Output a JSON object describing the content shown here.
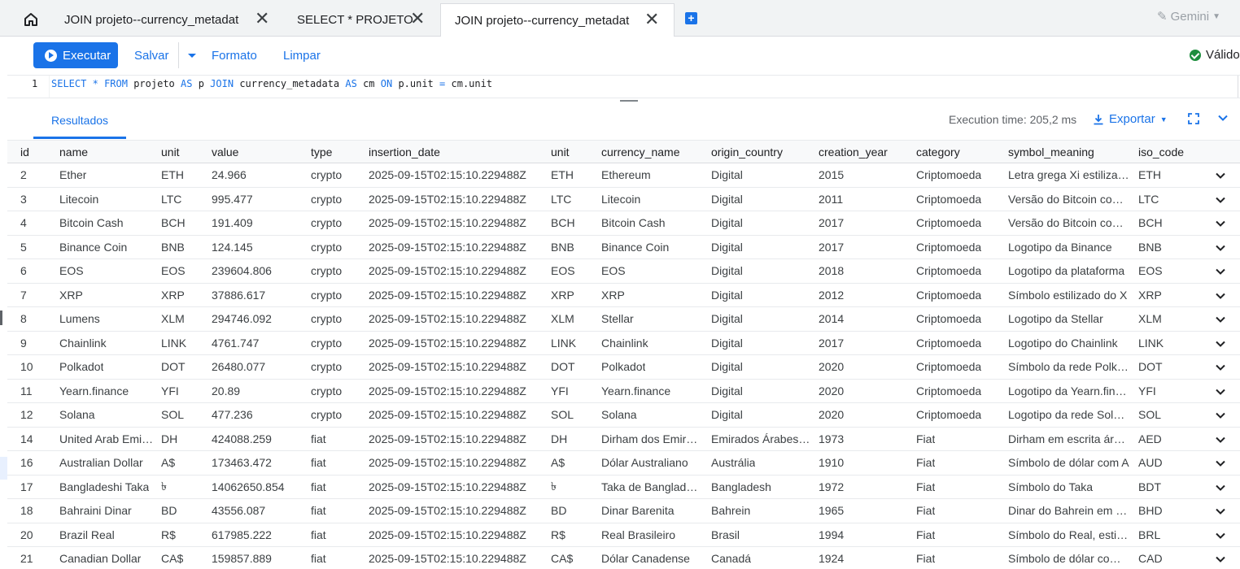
{
  "tabs": [
    {
      "label": "JOIN projeto--currency_metadat",
      "active": false
    },
    {
      "label": "SELECT * PROJETO",
      "active": false
    },
    {
      "label": "JOIN projeto--currency_metadat",
      "active": true
    }
  ],
  "gemini_label": "Gemini",
  "toolbar": {
    "run_label": "Executar",
    "save_label": "Salvar",
    "format_label": "Formato",
    "clear_label": "Limpar",
    "status_label": "Válido"
  },
  "editor": {
    "line_number": "1",
    "query": "SELECT * FROM projeto AS p JOIN currency_metadata AS cm ON p.unit = cm.unit"
  },
  "results": {
    "tab_label": "Resultados",
    "execution_time": "Execution time: 205,2 ms",
    "export_label": "Exportar",
    "columns": [
      "id",
      "name",
      "unit",
      "value",
      "type",
      "insertion_date",
      "unit",
      "currency_name",
      "origin_country",
      "creation_year",
      "category",
      "symbol_meaning",
      "iso_code"
    ],
    "rows": [
      [
        "2",
        "Ether",
        "ETH",
        "24.966",
        "crypto",
        "2025-09-15T02:15:10.229488Z",
        "ETH",
        "Ethereum",
        "Digital",
        "2015",
        "Criptomoeda",
        "Letra grega Xi estilizada",
        "ETH"
      ],
      [
        "3",
        "Litecoin",
        "LTC",
        "995.477",
        "crypto",
        "2025-09-15T02:15:10.229488Z",
        "LTC",
        "Litecoin",
        "Digital",
        "2011",
        "Criptomoeda",
        "Versão do Bitcoin com L",
        "LTC"
      ],
      [
        "4",
        "Bitcoin Cash",
        "BCH",
        "191.409",
        "crypto",
        "2025-09-15T02:15:10.229488Z",
        "BCH",
        "Bitcoin Cash",
        "Digital",
        "2017",
        "Criptomoeda",
        "Versão do Bitcoin com B",
        "BCH"
      ],
      [
        "5",
        "Binance Coin",
        "BNB",
        "124.145",
        "crypto",
        "2025-09-15T02:15:10.229488Z",
        "BNB",
        "Binance Coin",
        "Digital",
        "2017",
        "Criptomoeda",
        "Logotipo da Binance",
        "BNB"
      ],
      [
        "6",
        "EOS",
        "EOS",
        "239604.806",
        "crypto",
        "2025-09-15T02:15:10.229488Z",
        "EOS",
        "EOS",
        "Digital",
        "2018",
        "Criptomoeda",
        "Logotipo da plataforma",
        "EOS"
      ],
      [
        "7",
        "XRP",
        "XRP",
        "37886.617",
        "crypto",
        "2025-09-15T02:15:10.229488Z",
        "XRP",
        "XRP",
        "Digital",
        "2012",
        "Criptomoeda",
        "Símbolo estilizado do X",
        "XRP"
      ],
      [
        "8",
        "Lumens",
        "XLM",
        "294746.092",
        "crypto",
        "2025-09-15T02:15:10.229488Z",
        "XLM",
        "Stellar",
        "Digital",
        "2014",
        "Criptomoeda",
        "Logotipo da Stellar",
        "XLM"
      ],
      [
        "9",
        "Chainlink",
        "LINK",
        "4761.747",
        "crypto",
        "2025-09-15T02:15:10.229488Z",
        "LINK",
        "Chainlink",
        "Digital",
        "2017",
        "Criptomoeda",
        "Logotipo do Chainlink",
        "LINK"
      ],
      [
        "10",
        "Polkadot",
        "DOT",
        "26480.077",
        "crypto",
        "2025-09-15T02:15:10.229488Z",
        "DOT",
        "Polkadot",
        "Digital",
        "2020",
        "Criptomoeda",
        "Símbolo da rede Polkadot",
        "DOT"
      ],
      [
        "11",
        "Yearn.finance",
        "YFI",
        "20.89",
        "crypto",
        "2025-09-15T02:15:10.229488Z",
        "YFI",
        "Yearn.finance",
        "Digital",
        "2020",
        "Criptomoeda",
        "Logotipo da Yearn.finance",
        "YFI"
      ],
      [
        "12",
        "Solana",
        "SOL",
        "477.236",
        "crypto",
        "2025-09-15T02:15:10.229488Z",
        "SOL",
        "Solana",
        "Digital",
        "2020",
        "Criptomoeda",
        "Logotipo da rede Solana",
        "SOL"
      ],
      [
        "14",
        "United Arab Emirates Dirham",
        "DH",
        "424088.259",
        "fiat",
        "2025-09-15T02:15:10.229488Z",
        "DH",
        "Dirham dos Emirados",
        "Emirados Árabes Unidos",
        "1973",
        "Fiat",
        "Dirham em escrita árabe",
        "AED"
      ],
      [
        "16",
        "Australian Dollar",
        "A$",
        "173463.472",
        "fiat",
        "2025-09-15T02:15:10.229488Z",
        "A$",
        "Dólar Australiano",
        "Austrália",
        "1910",
        "Fiat",
        "Símbolo de dólar com A",
        "AUD"
      ],
      [
        "17",
        "Bangladeshi Taka",
        "৳",
        "14062650.854",
        "fiat",
        "2025-09-15T02:15:10.229488Z",
        "৳",
        "Taka de Bangladesh",
        "Bangladesh",
        "1972",
        "Fiat",
        "Símbolo do Taka",
        "BDT"
      ],
      [
        "18",
        "Bahraini Dinar",
        "BD",
        "43556.087",
        "fiat",
        "2025-09-15T02:15:10.229488Z",
        "BD",
        "Dinar Barenita",
        "Bahrein",
        "1965",
        "Fiat",
        "Dinar do Bahrein em sigla",
        "BHD"
      ],
      [
        "20",
        "Brazil Real",
        "R$",
        "617985.222",
        "fiat",
        "2025-09-15T02:15:10.229488Z",
        "R$",
        "Real Brasileiro",
        "Brasil",
        "1994",
        "Fiat",
        "Símbolo do Real, estilizado",
        "BRL"
      ],
      [
        "21",
        "Canadian Dollar",
        "CA$",
        "159857.889",
        "fiat",
        "2025-09-15T02:15:10.229488Z",
        "CA$",
        "Dólar Canadense",
        "Canadá",
        "1924",
        "Fiat",
        "Símbolo de dólar com CA",
        "CAD"
      ]
    ]
  },
  "colors": {
    "accent": "#1a73e8",
    "valid": "#1e8e3e",
    "header_bg": "#f8f9fa"
  }
}
